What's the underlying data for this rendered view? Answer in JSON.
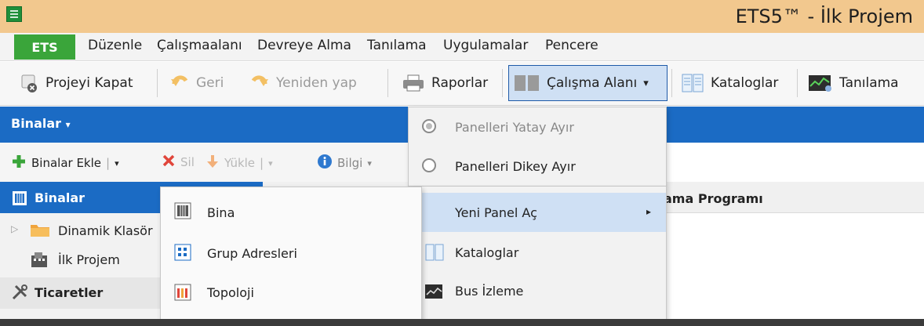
{
  "window": {
    "title": "ETS5™ - İlk Projem"
  },
  "menubar": {
    "ets_tab": "ETS",
    "items": [
      "Düzenle",
      "Çalışmaalanı",
      "Devreye Alma",
      "Tanılama",
      "Uygulamalar",
      "Pencere"
    ]
  },
  "toolbar": {
    "close_project": "Projeyi Kapat",
    "undo": "Geri",
    "redo": "Yeniden yap",
    "reports": "Raporlar",
    "workspace": "Çalışma Alanı",
    "workspace_arrow": "▾",
    "catalogs": "Kataloglar",
    "diagnostics": "Tanılama"
  },
  "panel": {
    "header": "Binalar",
    "header_arrow": "▾",
    "add_buildings": "Binalar Ekle",
    "delete": "Sil",
    "download": "Yükle",
    "info": "Bilgi",
    "dropdown_arrow": "▾",
    "pipe": "|"
  },
  "tree": {
    "header": "Binalar",
    "items": [
      "Dinamik Klasör",
      "İlk Projem"
    ],
    "trades": "Ticaretler"
  },
  "right_panel": {
    "partial_header": "ama Programı"
  },
  "workspace_menu": {
    "items": [
      {
        "label": "Panelleri Yatay Ayır",
        "selected": true
      },
      {
        "label": "Panelleri Dikey Ayır",
        "selected": false
      }
    ]
  },
  "newpanel_menu": {
    "items": [
      {
        "label": "Yeni Panel Aç",
        "submenu": true,
        "arrow": "▸"
      },
      {
        "label": "Kataloglar"
      },
      {
        "label": "Bus İzleme"
      }
    ]
  },
  "bina_menu": {
    "items": [
      "Bina",
      "Grup Adresleri",
      "Topoloji"
    ]
  },
  "colors": {
    "accent": "#1b6bc4",
    "title_bar": "#f2c88e",
    "ets_green": "#3aa53a"
  }
}
